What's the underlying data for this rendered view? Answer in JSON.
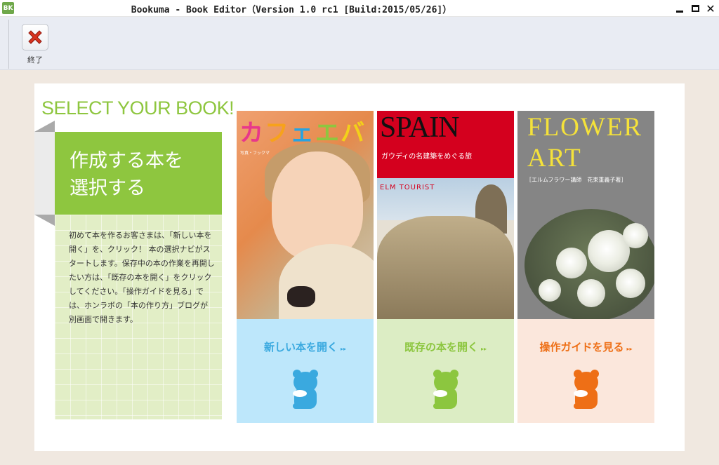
{
  "window": {
    "app_icon": "BK",
    "title": "Bookuma - Book Editor（Version 1.0 rc1 [Build:2015/05/26]）",
    "minimize_icon": "minimize-icon",
    "maximize_icon": "maximize-icon",
    "close_icon": "close-icon",
    "close_glyph": "✕"
  },
  "toolbar": {
    "exit_label": "終了",
    "exit_icon": "red-x-icon"
  },
  "main": {
    "heading": "SELECT YOUR BOOK!",
    "card_title": "作成する本を選択する",
    "description": "初めて本を作るお客さまは、「新しい本を 開く」を、クリック！ 本の選択ナビがスタートします。保存中の本の作業を再開したい方は、「既存の本を開く」をクリックしてください。「操作ガイドを見る」では、ホンラボの「本の作り方」ブログが別画面で開きます。"
  },
  "books": [
    {
      "cover_title": "カフェエバ",
      "cover_subtitle": "写真・フックマ",
      "action_label": "新しい本を開く",
      "arrow": "▸▸",
      "action_bg": "#bde7fb",
      "action_color": "#3aa9df"
    },
    {
      "cover_title": "SPAIN",
      "cover_subtitle": "ガウディの名建築をめぐる旅",
      "cover_brand": "ELM TOURIST",
      "action_label": "既存の本を開く",
      "arrow": "▸▸",
      "action_bg": "#dcedc4",
      "action_color": "#8cc63f"
    },
    {
      "cover_title": "FLOWER ART",
      "cover_subtitle": "［エルムフラワー講師　花束重義子著］",
      "action_label": "操作ガイドを見る",
      "arrow": "▸▸",
      "action_bg": "#fbe7dc",
      "action_color": "#ee6f16"
    }
  ],
  "colors": {
    "accent_green": "#8ec63f",
    "workspace_bg": "#f0e8e0"
  }
}
